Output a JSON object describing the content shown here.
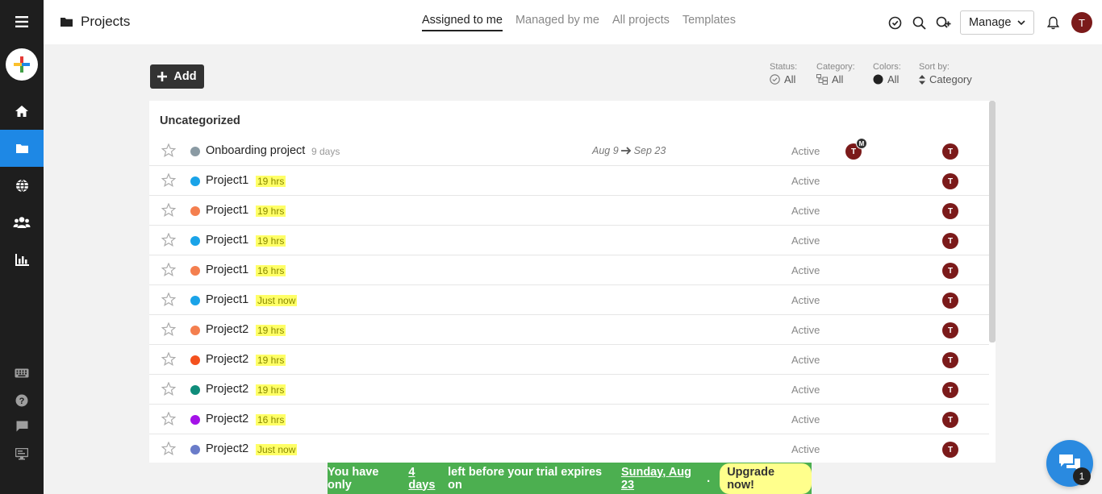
{
  "header": {
    "title": "Projects",
    "tabs": [
      {
        "label": "Assigned to me",
        "active": true
      },
      {
        "label": "Managed by me",
        "active": false
      },
      {
        "label": "All projects",
        "active": false
      },
      {
        "label": "Templates",
        "active": false
      }
    ],
    "manage_label": "Manage",
    "avatar_initial": "T"
  },
  "sidebar": {
    "items": [
      {
        "icon": "menu-icon"
      },
      {
        "icon": "add-icon"
      },
      {
        "icon": "home-icon"
      },
      {
        "icon": "folder-icon",
        "active": true
      },
      {
        "icon": "globe-icon"
      },
      {
        "icon": "users-icon"
      },
      {
        "icon": "chart-icon"
      },
      {
        "icon": "keyboard-icon"
      },
      {
        "icon": "help-icon"
      },
      {
        "icon": "chat-icon"
      },
      {
        "icon": "monitor-icon"
      }
    ]
  },
  "toolbar": {
    "add_label": "Add",
    "filters": {
      "status": {
        "label": "Status:",
        "value": "All"
      },
      "category": {
        "label": "Category:",
        "value": "All"
      },
      "colors": {
        "label": "Colors:",
        "value": "All"
      },
      "sort": {
        "label": "Sort by:",
        "value": "Category"
      }
    }
  },
  "list": {
    "group_title": "Uncategorized",
    "rows": [
      {
        "name": "Onboarding project",
        "color": "#8a9aa3",
        "time": "9 days",
        "time_style": "plain",
        "start": "Aug 9",
        "end": "Sep 23",
        "status": "Active",
        "manager": "T",
        "manager_badge": "M",
        "assignee": "T"
      },
      {
        "name": "Project1",
        "color": "#1aa3e8",
        "time": "19 hrs",
        "time_style": "hl",
        "status": "Active",
        "assignee": "T"
      },
      {
        "name": "Project1",
        "color": "#f47f4f",
        "time": "19 hrs",
        "time_style": "hl",
        "status": "Active",
        "assignee": "T"
      },
      {
        "name": "Project1",
        "color": "#1aa3e8",
        "time": "19 hrs",
        "time_style": "hl",
        "status": "Active",
        "assignee": "T"
      },
      {
        "name": "Project1",
        "color": "#f47f4f",
        "time": "16 hrs",
        "time_style": "hl",
        "status": "Active",
        "assignee": "T"
      },
      {
        "name": "Project1",
        "color": "#1aa3e8",
        "time": "Just now",
        "time_style": "hl",
        "status": "Active",
        "assignee": "T"
      },
      {
        "name": "Project2",
        "color": "#f47f4f",
        "time": "19 hrs",
        "time_style": "hl",
        "status": "Active",
        "assignee": "T"
      },
      {
        "name": "Project2",
        "color": "#f4511e",
        "time": "19 hrs",
        "time_style": "hl",
        "status": "Active",
        "assignee": "T"
      },
      {
        "name": "Project2",
        "color": "#0f8c7a",
        "time": "19 hrs",
        "time_style": "hl",
        "status": "Active",
        "assignee": "T"
      },
      {
        "name": "Project2",
        "color": "#a412e8",
        "time": "16 hrs",
        "time_style": "hl",
        "status": "Active",
        "assignee": "T"
      },
      {
        "name": "Project2",
        "color": "#6a7cc9",
        "time": "Just now",
        "time_style": "hl",
        "status": "Active",
        "assignee": "T"
      }
    ]
  },
  "trial": {
    "prefix": "You have only",
    "days": "4 days",
    "middle": "left before your trial expires on",
    "date": "Sunday, Aug 23",
    "suffix": ".",
    "cta": "Upgrade now!"
  },
  "chat": {
    "count": "1"
  }
}
